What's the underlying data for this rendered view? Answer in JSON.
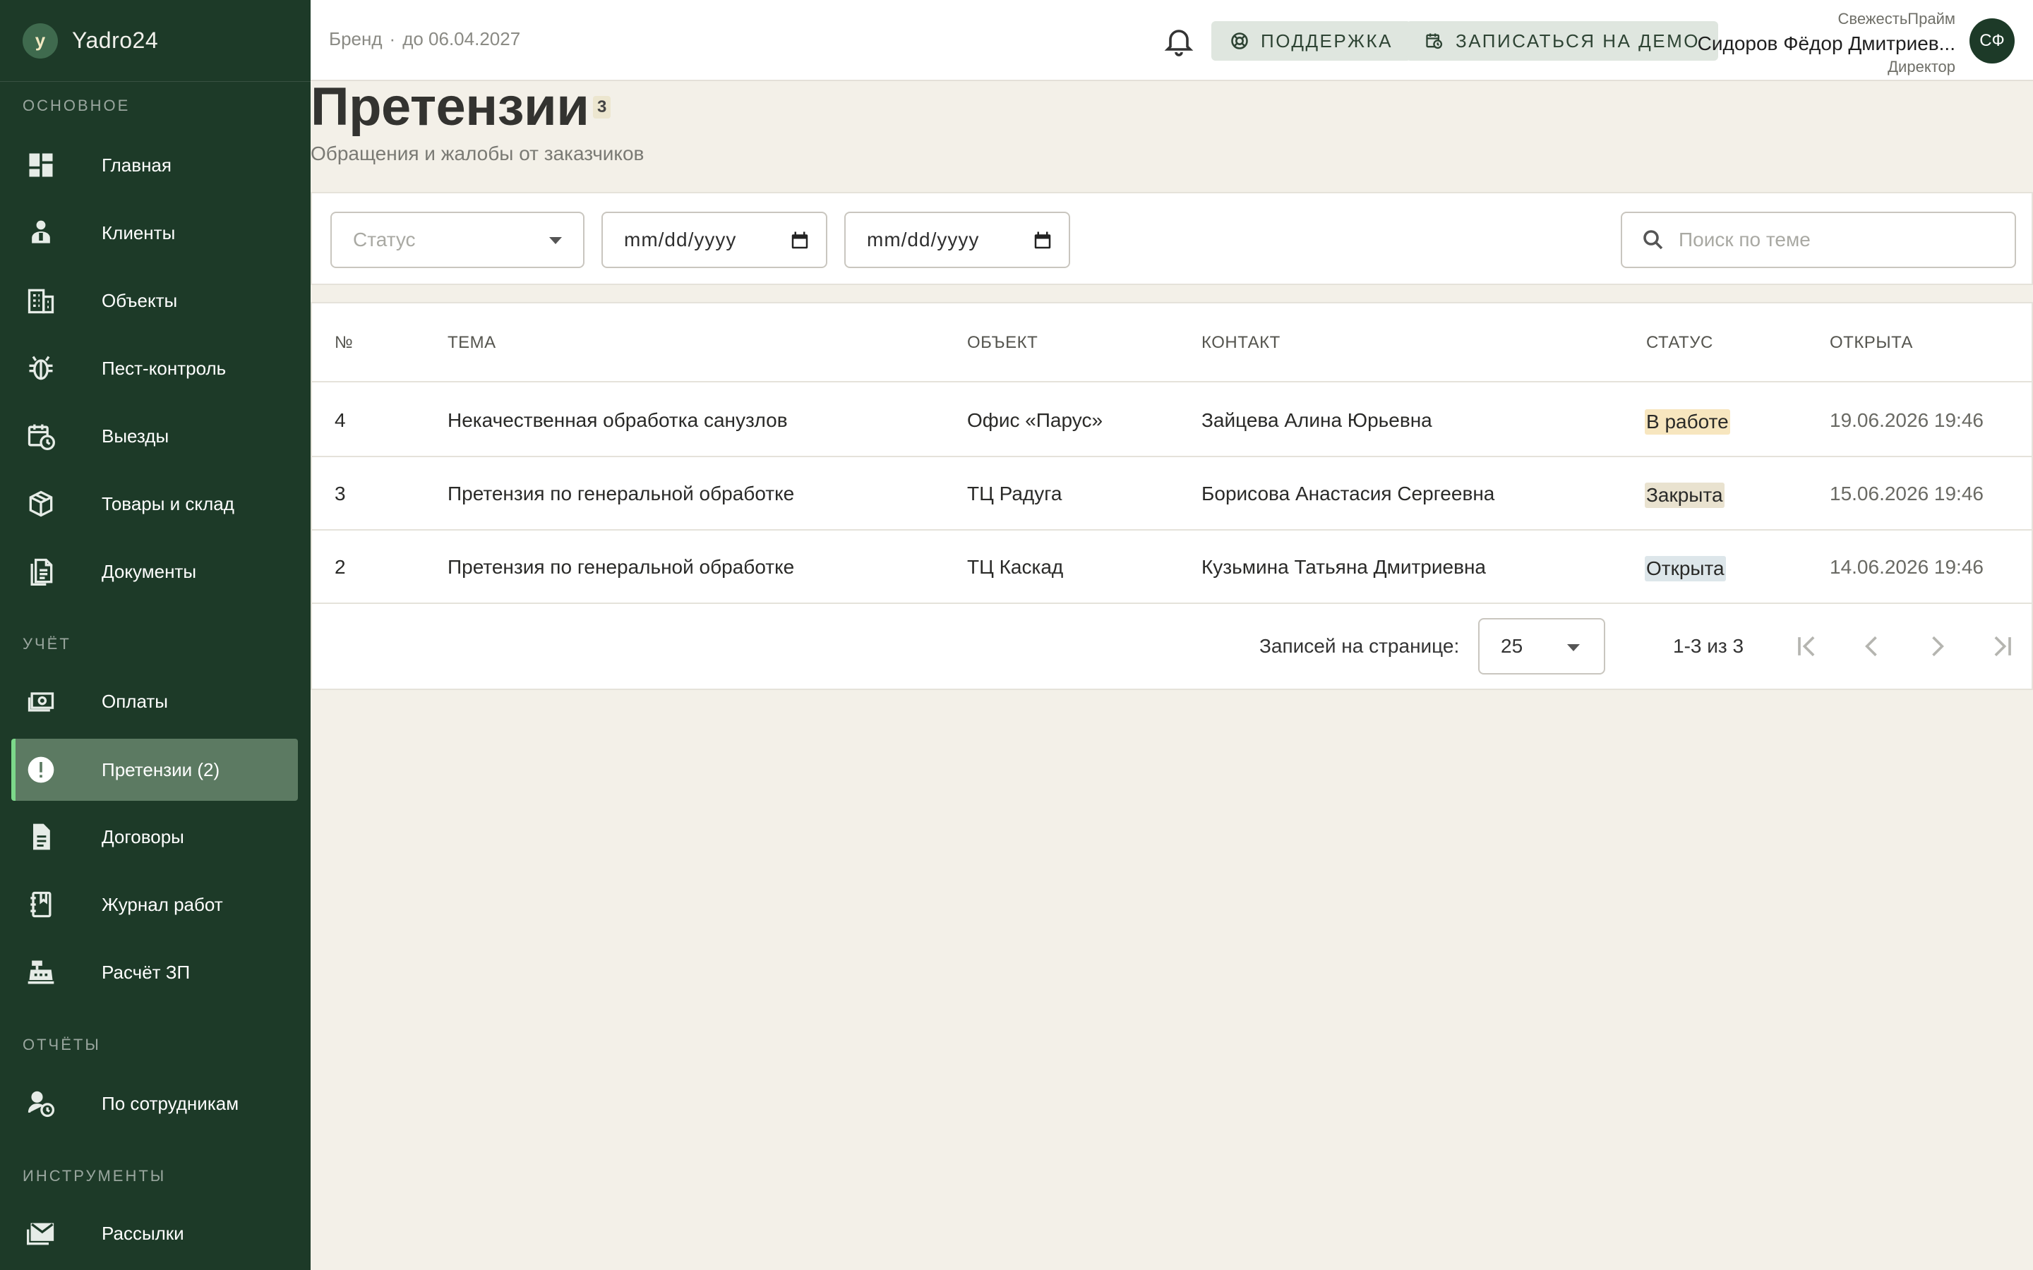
{
  "app": {
    "logo_letter": "y",
    "name": "Yadro24"
  },
  "sidebar": {
    "sections": {
      "main": "ОСНОВНОЕ",
      "accounting": "УЧЁТ",
      "reports": "ОТЧЁТЫ",
      "tools": "ИНСТРУМЕНТЫ"
    },
    "items": [
      {
        "label": "Главная",
        "icon": "dashboard-icon"
      },
      {
        "label": "Клиенты",
        "icon": "clients-icon"
      },
      {
        "label": "Объекты",
        "icon": "building-icon"
      },
      {
        "label": "Пест-контроль",
        "icon": "bug-icon"
      },
      {
        "label": "Выезды",
        "icon": "calendar-clock-icon"
      },
      {
        "label": "Товары и склад",
        "icon": "box-icon"
      },
      {
        "label": "Документы",
        "icon": "documents-icon"
      },
      {
        "label": "Оплаты",
        "icon": "payments-icon"
      },
      {
        "label": "Претензии (2)",
        "icon": "alert-icon",
        "active": true
      },
      {
        "label": "Договоры",
        "icon": "contract-icon"
      },
      {
        "label": "Журнал работ",
        "icon": "journal-icon"
      },
      {
        "label": "Расчёт ЗП",
        "icon": "cash-register-icon"
      },
      {
        "label": "По сотрудникам",
        "icon": "user-clock-icon"
      },
      {
        "label": "Рассылки",
        "icon": "mail-icon"
      }
    ]
  },
  "header": {
    "brand": "Бренд",
    "separator": "·",
    "valid_until": "до 06.04.2027",
    "support_label": "ПОДДЕРЖКА",
    "demo_label": "ЗАПИСАТЬСЯ НА ДЕМО",
    "user": {
      "company": "СвежестьПрайм",
      "name": "Сидоров Фёдор Дмитриев...",
      "role": "Директор",
      "initials": "СФ"
    }
  },
  "page": {
    "title": "Претензии",
    "count": "3",
    "subtitle": "Обращения и жалобы от заказчиков"
  },
  "filters": {
    "status_placeholder": "Статус",
    "date_from": "mm/dd/yyyy",
    "date_to": "mm/dd/yyyy",
    "search_placeholder": "Поиск по теме"
  },
  "table": {
    "columns": [
      "№",
      "ТЕМА",
      "ОБЪЕКТ",
      "КОНТАКТ",
      "СТАТУС",
      "ОТКРЫТА"
    ],
    "rows": [
      {
        "num": "4",
        "topic": "Некачественная обработка санузлов",
        "object": "Офис «Парус»",
        "contact": "Зайцева Алина Юрьевна",
        "status": "В работе",
        "opened": "19.06.2026 19:46"
      },
      {
        "num": "3",
        "topic": "Претензия по генеральной обработке",
        "object": "ТЦ Радуга",
        "contact": "Борисова Анастасия Сергеевна",
        "status": "Закрыта",
        "opened": "15.06.2026 19:46"
      },
      {
        "num": "2",
        "topic": "Претензия по генеральной обработке",
        "object": "ТЦ Каскад",
        "contact": "Кузьмина Татьяна Дмитриевна",
        "status": "Открыта",
        "opened": "14.06.2026 19:46"
      }
    ],
    "status_colors": {
      "В работе": "#f7e6bf",
      "Закрыта": "#e9e2cf",
      "Открыта": "#dde6ea"
    }
  },
  "pagination": {
    "per_page_label": "Записей на странице:",
    "per_page": "25",
    "range": "1-3 из 3"
  },
  "colors": {
    "sidebar": "#1d3a28",
    "active_item": "#5c7a62",
    "accent": "#7cd88a"
  }
}
